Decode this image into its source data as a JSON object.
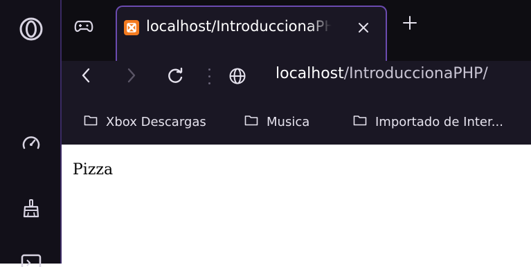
{
  "colors": {
    "sidebar_bg": "#121019",
    "tabstrip_bg": "#0e0d12",
    "toolbar_bg": "#1a1724",
    "accent": "#6b4bb0",
    "favicon": "#f47b20"
  },
  "sidebar": {
    "items": [
      {
        "icon": "opera-logo-icon"
      },
      {
        "icon": "speed-dial-icon"
      },
      {
        "icon": "cleaner-icon"
      },
      {
        "icon": "news-icon"
      }
    ]
  },
  "tabs": {
    "gamepad_icon": "gamepad-icon",
    "active": {
      "favicon": "xampp-icon",
      "title": "localhost/IntroduccionaPHP/"
    },
    "new_tab_icon": "plus-icon"
  },
  "address_bar": {
    "host": "localhost",
    "path": "/IntroduccionaPHP/"
  },
  "bookmarks": [
    {
      "label": "Xbox Descargas"
    },
    {
      "label": "Musica"
    },
    {
      "label": "Importado de Inter..."
    }
  ],
  "page": {
    "text": "Pizza"
  }
}
